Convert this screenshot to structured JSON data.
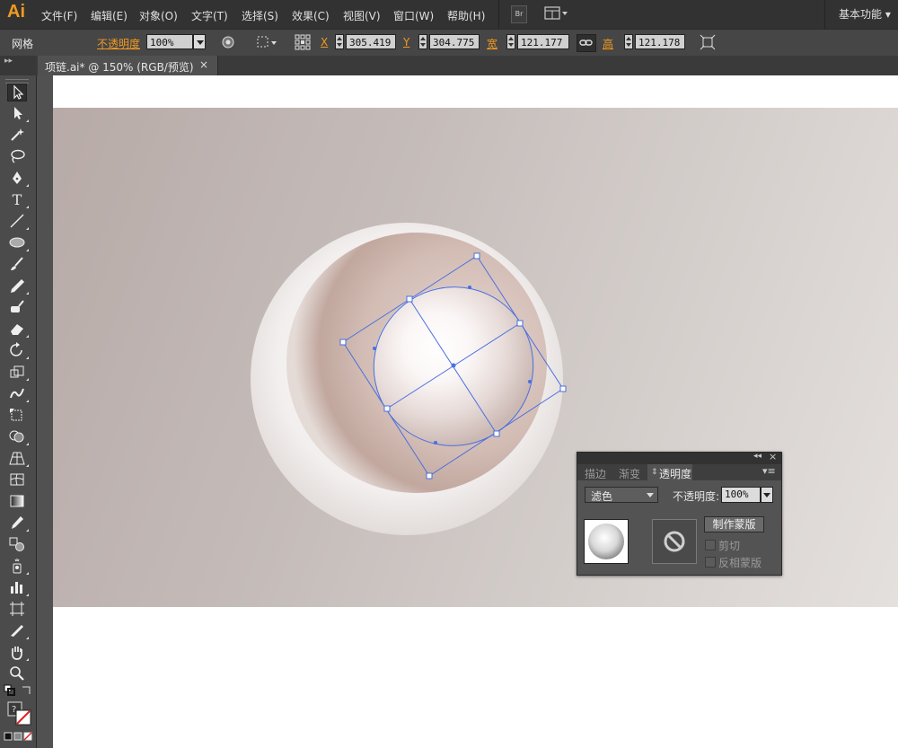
{
  "app": {
    "logo": "Ai",
    "workspace": "基本功能 ▾"
  },
  "menu": [
    "文件(F)",
    "编辑(E)",
    "对象(O)",
    "文字(T)",
    "选择(S)",
    "效果(C)",
    "视图(V)",
    "窗口(W)",
    "帮助(H)"
  ],
  "menubar_buttons": {
    "bridge": "Br"
  },
  "control": {
    "label": "网格",
    "opacity_label": "不透明度",
    "opacity_value": "100%",
    "x_label": "X",
    "x_value": "305.419",
    "x_unit": "",
    "y_label": "Y",
    "y_value": "304.775",
    "w_label": "宽",
    "w_value": "121.177",
    "h_label": "高",
    "h_value": "121.178"
  },
  "tab": {
    "title": "项链.ai* @ 150% (RGB/预览)",
    "close": "×"
  },
  "panel": {
    "tabs": [
      "描边",
      "渐变",
      "透明度"
    ],
    "active_tab": "透明度",
    "blend_mode": "滤色",
    "opacity_label": "不透明度:",
    "opacity_value": "100%",
    "make_mask": "制作蒙版",
    "clip": "剪切",
    "invert_mask": "反相蒙版"
  },
  "colors": {
    "accent": "#f29a1f",
    "selection": "#4a6fe0"
  },
  "icons": [
    "selection-tool-icon",
    "direct-selection-tool-icon",
    "magic-wand-icon",
    "lasso-icon",
    "pen-icon",
    "type-icon",
    "line-icon",
    "ellipse-icon",
    "paintbrush-icon",
    "pencil-icon",
    "blob-brush-icon",
    "eraser-icon",
    "rotate-icon",
    "scale-icon",
    "warp-icon",
    "free-transform-icon",
    "shape-builder-icon",
    "perspective-grid-icon",
    "mesh-icon",
    "gradient-icon",
    "eyedropper-icon",
    "blend-icon",
    "symbol-sprayer-icon",
    "column-graph-icon",
    "artboard-icon",
    "slice-icon",
    "hand-icon",
    "zoom-icon"
  ]
}
